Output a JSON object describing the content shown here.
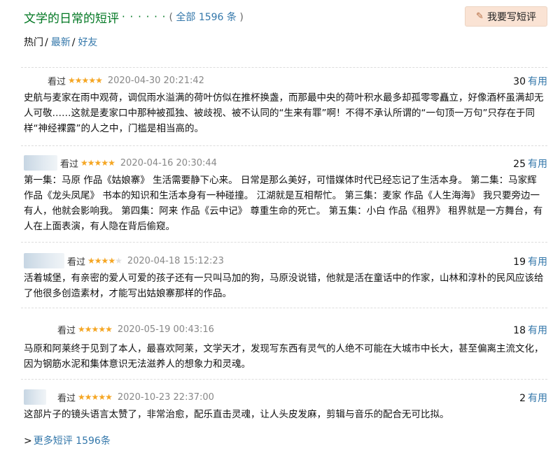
{
  "header": {
    "title": "文学的日常的短评",
    "dots": "· · · · · ·",
    "all_prefix": "( ",
    "all_link": "全部 1596 条",
    "all_suffix": " )",
    "write_button": "我要写短评"
  },
  "filters": {
    "hot": "热门",
    "latest": "最新",
    "friends": "好友",
    "separator": "/"
  },
  "useful_label": "有用",
  "comments": [
    {
      "watched": "看过",
      "stars": 5,
      "time": "2020-04-30 20:21:42",
      "votes": "30",
      "text": "史航与麦家在雨中观荷，调侃雨水溢满的荷叶仿似在推杯换盏，而那最中央的荷叶积水最多却孤零零矗立，好像酒杯虽满却无人可敬……这就是麦家口中那种被孤独、被歧视、被不认同的“生来有罪”啊！不得不承认所谓的“一句顶一万句”只存在于同样“神经裸露”的人之中，门槛是相当高的。"
    },
    {
      "watched": "看过",
      "stars": 5,
      "time": "2020-04-16 20:30:44",
      "votes": "25",
      "text": "第一集：马原 作品《姑娘寨》 生活需要静下心来。 日常是那么美好，可惜媒体时代已经忘记了生活本身。 第二集：马家辉 作品《龙头凤尾》 书本的知识和生活本身有一种碰撞。 江湖就是互相帮忙。 第三集：麦家 作品《人生海海》 我只要旁边一有人，他就会影响我。 第四集：阿来 作品《云中记》 尊重生命的死亡。 第五集：小白 作品《租界》 租界就是一方舞台，有人在上面表演，有人隐在背后偷窥。"
    },
    {
      "watched": "看过",
      "stars": 4,
      "time": "2020-04-18 15:12:23",
      "votes": "19",
      "text": "活着城堡，有亲密的爱人可爱的孩子还有一只叫马加的狗，马原没说错，他就是活在童话中的作家，山林和淳朴的民风应该给了他很多创造素材，才能写出姑娘寨那样的作品。"
    },
    {
      "watched": "看过",
      "stars": 5,
      "time": "2020-05-19 00:43:16",
      "votes": "18",
      "text": "马原和阿莱终于见到了本人，最喜欢阿莱，文学天才，发现写东西有灵气的人绝不可能在大城市中长大，甚至偏离主流文化，因为钢筋水泥和集体意识无法滋养人的想象力和灵魂。"
    },
    {
      "watched": "看过",
      "stars": 5,
      "time": "2020-10-23 22:37:00",
      "votes": "2",
      "text": "这部片子的镜头语言太赞了，非常治愈，配乐直击灵魂，让人头皮发麻，剪辑与音乐的配合无可比拟。"
    }
  ],
  "more": {
    "arrow": ">",
    "label": "更多短评 1596条"
  }
}
